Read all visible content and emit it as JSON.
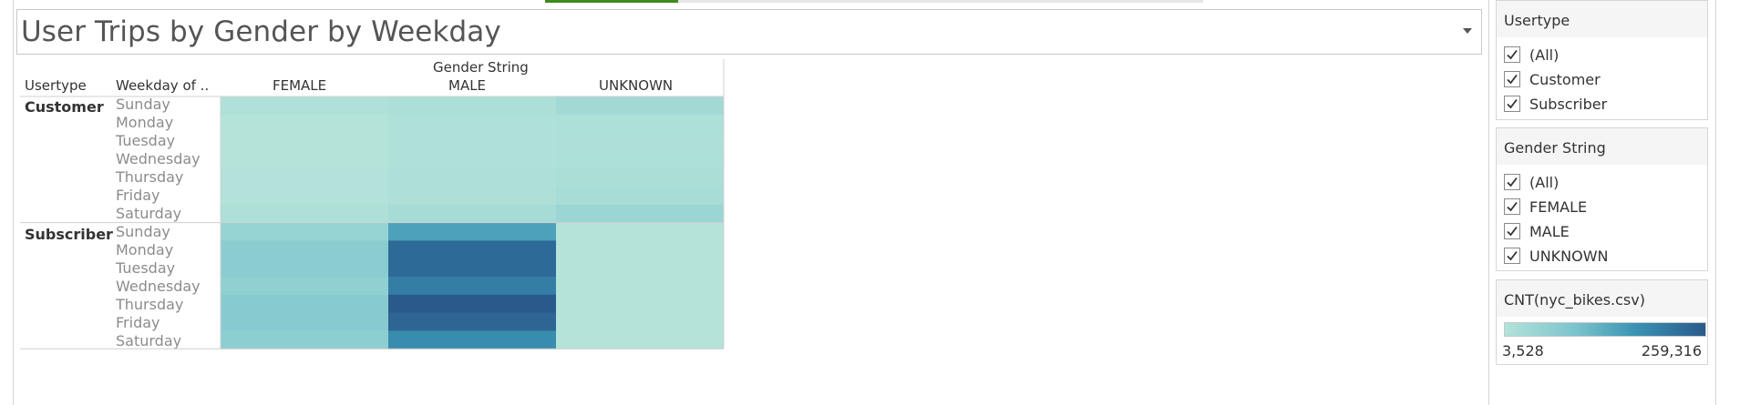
{
  "dashboard": {
    "title": "User Trips by Gender by Weekday"
  },
  "chart_data": {
    "type": "heatmap",
    "title": "User Trips by Gender by Weekday",
    "column_header_title": "Gender String",
    "row_header_titles": [
      "Usertype",
      "Weekday of .."
    ],
    "columns": [
      "FEMALE",
      "MALE",
      "UNKNOWN"
    ],
    "usertypes": [
      "Customer",
      "Subscriber"
    ],
    "weekdays": [
      "Sunday",
      "Monday",
      "Tuesday",
      "Wednesday",
      "Thursday",
      "Friday",
      "Saturday"
    ],
    "color_measure": "CNT(nyc_bikes.csv)",
    "color_min": 3528,
    "color_max": 259316,
    "color_range": [
      "#b3e3d9",
      "#7cc4cd",
      "#3a93b3",
      "#2a5a8c"
    ],
    "values": {
      "Customer": {
        "FEMALE": [
          10000,
          3600,
          3600,
          3600,
          5500,
          5800,
          12000
        ],
        "MALE": [
          15000,
          9000,
          9000,
          9000,
          12000,
          12000,
          22000
        ],
        "UNKNOWN": [
          30000,
          13000,
          12000,
          13000,
          17000,
          20000,
          41000
        ]
      },
      "Subscriber": {
        "FEMALE": [
          48000,
          66000,
          67000,
          57000,
          72000,
          71000,
          62000
        ],
        "MALE": [
          150000,
          236000,
          236000,
          205000,
          259316,
          243000,
          184000
        ],
        "UNKNOWN": [
          3528,
          3528,
          3528,
          3528,
          3528,
          3528,
          3528
        ]
      }
    }
  },
  "filters": [
    {
      "title": "Usertype",
      "options": [
        {
          "label": "(All)",
          "checked": true
        },
        {
          "label": "Customer",
          "checked": true
        },
        {
          "label": "Subscriber",
          "checked": true
        }
      ]
    },
    {
      "title": "Gender String",
      "options": [
        {
          "label": "(All)",
          "checked": true
        },
        {
          "label": "FEMALE",
          "checked": true
        },
        {
          "label": "MALE",
          "checked": true
        },
        {
          "label": "UNKNOWN",
          "checked": true
        }
      ]
    }
  ],
  "legend": {
    "title": "CNT(nyc_bikes.csv)",
    "min_label": "3,528",
    "max_label": "259,316"
  }
}
